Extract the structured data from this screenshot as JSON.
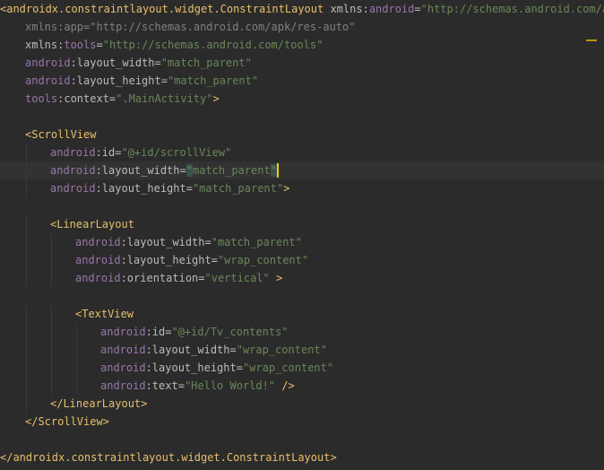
{
  "editor": {
    "language": "XML",
    "current_line": 9,
    "colors": {
      "background": "#2b2b2b",
      "current_line_background": "#323232",
      "tag": "#e8bf6a",
      "attribute": "#bababa",
      "namespace": "#9876aa",
      "string": "#6a8759",
      "punctuation": "#bababa",
      "faded": "#808080",
      "caret": "#ffcc00",
      "warning_marker": "#be9117"
    },
    "lines": [
      {
        "indent": 0,
        "tokens": [
          {
            "t": "<androidx.constraintlayout.widget.ConstraintLayout",
            "c": "tag"
          },
          {
            "t": " xmlns:",
            "c": "attr"
          },
          {
            "t": "android",
            "c": "ns"
          },
          {
            "t": "=",
            "c": "punct"
          },
          {
            "t": "\"http://schemas.android.com/apk",
            "c": "str"
          }
        ]
      },
      {
        "indent": 1,
        "tokens": [
          {
            "t": "xmlns:app=\"http://schemas.android.com/apk/res-auto\"",
            "c": "err"
          }
        ]
      },
      {
        "indent": 1,
        "tokens": [
          {
            "t": "xmlns:",
            "c": "attr"
          },
          {
            "t": "tools",
            "c": "ns"
          },
          {
            "t": "=",
            "c": "punct"
          },
          {
            "t": "\"http://schemas.android.com/tools\"",
            "c": "str"
          }
        ]
      },
      {
        "indent": 1,
        "tokens": [
          {
            "t": "android",
            "c": "ns"
          },
          {
            "t": ":layout_width=",
            "c": "attr"
          },
          {
            "t": "\"match_parent\"",
            "c": "str"
          }
        ]
      },
      {
        "indent": 1,
        "tokens": [
          {
            "t": "android",
            "c": "ns"
          },
          {
            "t": ":layout_height=",
            "c": "attr"
          },
          {
            "t": "\"match_parent\"",
            "c": "str"
          }
        ]
      },
      {
        "indent": 1,
        "tokens": [
          {
            "t": "tools",
            "c": "ns"
          },
          {
            "t": ":context=",
            "c": "attr"
          },
          {
            "t": "\".MainActivity\"",
            "c": "str"
          },
          {
            "t": ">",
            "c": "tag"
          }
        ]
      },
      {
        "indent": 0,
        "tokens": []
      },
      {
        "indent": 1,
        "tokens": [
          {
            "t": "<ScrollView",
            "c": "tag"
          }
        ]
      },
      {
        "indent": 2,
        "tokens": [
          {
            "t": "android",
            "c": "ns"
          },
          {
            "t": ":id=",
            "c": "attr"
          },
          {
            "t": "\"@+id/scrollView\"",
            "c": "str"
          }
        ]
      },
      {
        "indent": 2,
        "tokens": [
          {
            "t": "android",
            "c": "ns"
          },
          {
            "t": ":layout_width=",
            "c": "attr"
          },
          {
            "t": "\"",
            "c": "quote-cur"
          },
          {
            "t": "match_parent",
            "c": "str"
          },
          {
            "t": "\"",
            "c": "quote-close"
          }
        ]
      },
      {
        "indent": 2,
        "tokens": [
          {
            "t": "android",
            "c": "ns"
          },
          {
            "t": ":layout_height=",
            "c": "attr"
          },
          {
            "t": "\"match_parent\"",
            "c": "str"
          },
          {
            "t": ">",
            "c": "tag"
          }
        ]
      },
      {
        "indent": 0,
        "tokens": []
      },
      {
        "indent": 2,
        "tokens": [
          {
            "t": "<LinearLayout",
            "c": "tag"
          }
        ]
      },
      {
        "indent": 3,
        "tokens": [
          {
            "t": "android",
            "c": "ns"
          },
          {
            "t": ":layout_width=",
            "c": "attr"
          },
          {
            "t": "\"match_parent\"",
            "c": "str"
          }
        ]
      },
      {
        "indent": 3,
        "tokens": [
          {
            "t": "android",
            "c": "ns"
          },
          {
            "t": ":layout_height=",
            "c": "attr"
          },
          {
            "t": "\"wrap_content\"",
            "c": "str"
          }
        ]
      },
      {
        "indent": 3,
        "tokens": [
          {
            "t": "android",
            "c": "ns"
          },
          {
            "t": ":orientation=",
            "c": "attr"
          },
          {
            "t": "\"vertical\"",
            "c": "str"
          },
          {
            "t": " >",
            "c": "tag"
          }
        ]
      },
      {
        "indent": 0,
        "tokens": []
      },
      {
        "indent": 3,
        "tokens": [
          {
            "t": "<TextView",
            "c": "tag"
          }
        ]
      },
      {
        "indent": 4,
        "tokens": [
          {
            "t": "android",
            "c": "ns"
          },
          {
            "t": ":id=",
            "c": "attr"
          },
          {
            "t": "\"@+id/Tv_contents\"",
            "c": "str"
          }
        ]
      },
      {
        "indent": 4,
        "tokens": [
          {
            "t": "android",
            "c": "ns"
          },
          {
            "t": ":layout_width=",
            "c": "attr"
          },
          {
            "t": "\"wrap_content\"",
            "c": "str"
          }
        ]
      },
      {
        "indent": 4,
        "tokens": [
          {
            "t": "android",
            "c": "ns"
          },
          {
            "t": ":layout_height=",
            "c": "attr"
          },
          {
            "t": "\"wrap_content\"",
            "c": "str"
          }
        ]
      },
      {
        "indent": 4,
        "tokens": [
          {
            "t": "android",
            "c": "ns"
          },
          {
            "t": ":text=",
            "c": "attr"
          },
          {
            "t": "\"Hello World!\"",
            "c": "str"
          },
          {
            "t": " />",
            "c": "tag"
          }
        ]
      },
      {
        "indent": 2,
        "tokens": [
          {
            "t": "</LinearLayout>",
            "c": "tag"
          }
        ]
      },
      {
        "indent": 1,
        "tokens": [
          {
            "t": "</ScrollView>",
            "c": "tag"
          }
        ]
      },
      {
        "indent": 0,
        "tokens": []
      },
      {
        "indent": 0,
        "tokens": [
          {
            "t": "</androidx.constraintlayout.widget.ConstraintLayout>",
            "c": "tag"
          }
        ]
      }
    ]
  }
}
